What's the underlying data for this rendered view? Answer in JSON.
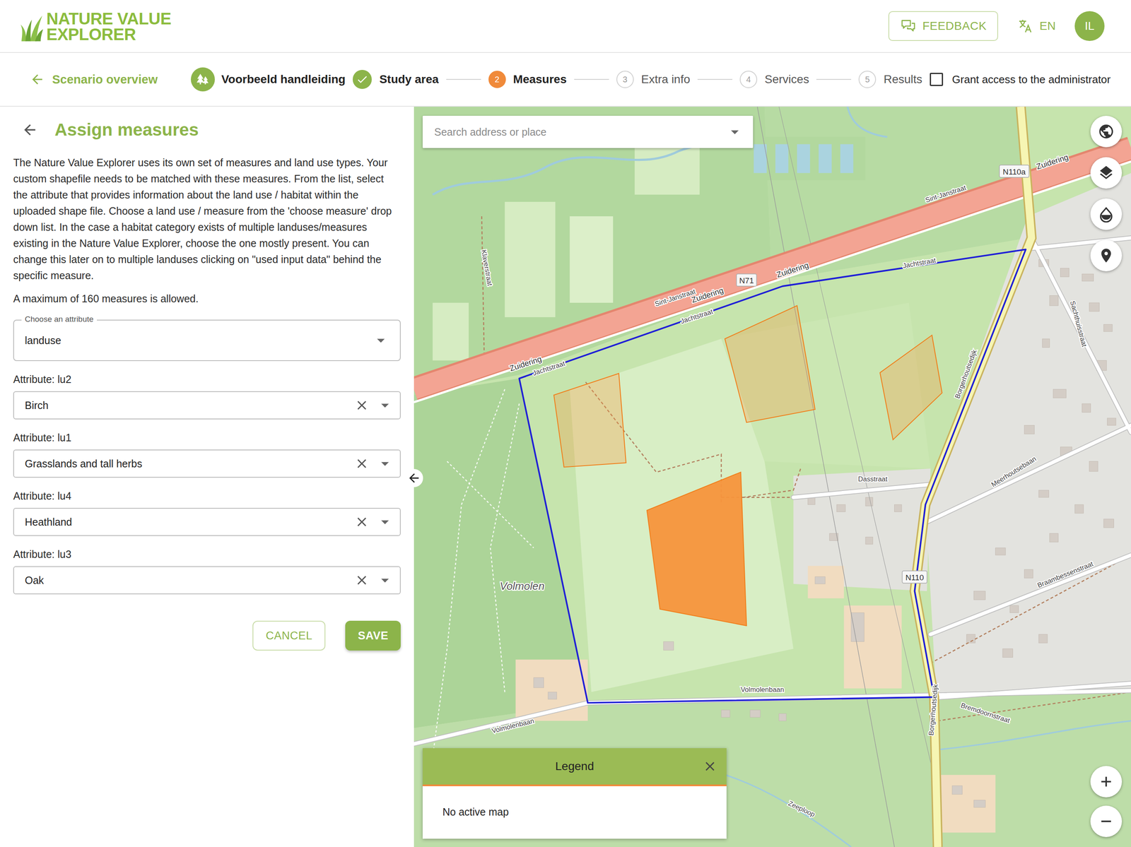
{
  "header": {
    "logo": [
      "NATURE VALUE",
      "EXPLORER"
    ],
    "feedback": "FEEDBACK",
    "language": "EN",
    "avatar": "IL"
  },
  "stepper": {
    "back": "Scenario overview",
    "scenario": "Voorbeeld handleiding",
    "steps": [
      {
        "number": "1",
        "label": "Study area",
        "done": true,
        "selected": false
      },
      {
        "number": "2",
        "label": "Measures",
        "done": false,
        "selected": true
      },
      {
        "number": "3",
        "label": "Extra info",
        "done": false,
        "selected": false
      },
      {
        "number": "4",
        "label": "Services",
        "done": false,
        "selected": false
      },
      {
        "number": "5",
        "label": "Results",
        "done": false,
        "selected": false
      }
    ],
    "grant_access": {
      "label": "Grant access to the administrator",
      "checked": false
    }
  },
  "panel": {
    "title": "Assign measures",
    "description": "The Nature Value Explorer uses its own set of measures and land use types. Your custom shapefile needs to be matched with these measures. From the list, select the attribute that provides information about the land use / habitat within the uploaded shape file. Choose a land use / measure from the 'choose measure' drop down list. In the case a habitat category exists of multiple landuses/measures existing in the Nature Value Explorer, choose the one mostly present. You can change this later on to multiple landuses clicking on \"used input data\" behind the specific measure.",
    "maximum": "A maximum of 160 measures is allowed.",
    "attribute_select": {
      "label": "Choose an attribute",
      "value": "landuse"
    },
    "assignments": [
      {
        "label": "Attribute: lu2",
        "value": "Birch"
      },
      {
        "label": "Attribute: lu1",
        "value": "Grasslands and tall herbs"
      },
      {
        "label": "Attribute: lu4",
        "value": "Heathland"
      },
      {
        "label": "Attribute: lu3",
        "value": "Oak"
      }
    ],
    "buttons": {
      "cancel": "CANCEL",
      "save": "SAVE"
    }
  },
  "map": {
    "search": {
      "placeholder": "Search address or place"
    },
    "labels": [
      "Zuidering",
      "Zuidering",
      "Zuidering",
      "Zuidering",
      "N71",
      "N110a",
      "Sint-Janstraat",
      "Sint-Janstraat",
      "Jachtstraat",
      "Jachtstraat",
      "Jachtstraat",
      "Klaverstraat",
      "Volmolen",
      "Dasstraat",
      "Meerhoutsebaan",
      "N110",
      "Volmolenbaan",
      "Volmolenbaan",
      "Borgerhoutsedijk",
      "Borgerhoutsedijk",
      "Bremdoornstraat",
      "Zeeploop",
      "Sachthuisstraat",
      "Braambessenstraat"
    ],
    "areas": [
      {
        "selected": false
      },
      {
        "selected": false
      },
      {
        "selected": false
      },
      {
        "selected": true
      }
    ],
    "legend": {
      "title": "Legend",
      "body": "No active map"
    }
  }
}
